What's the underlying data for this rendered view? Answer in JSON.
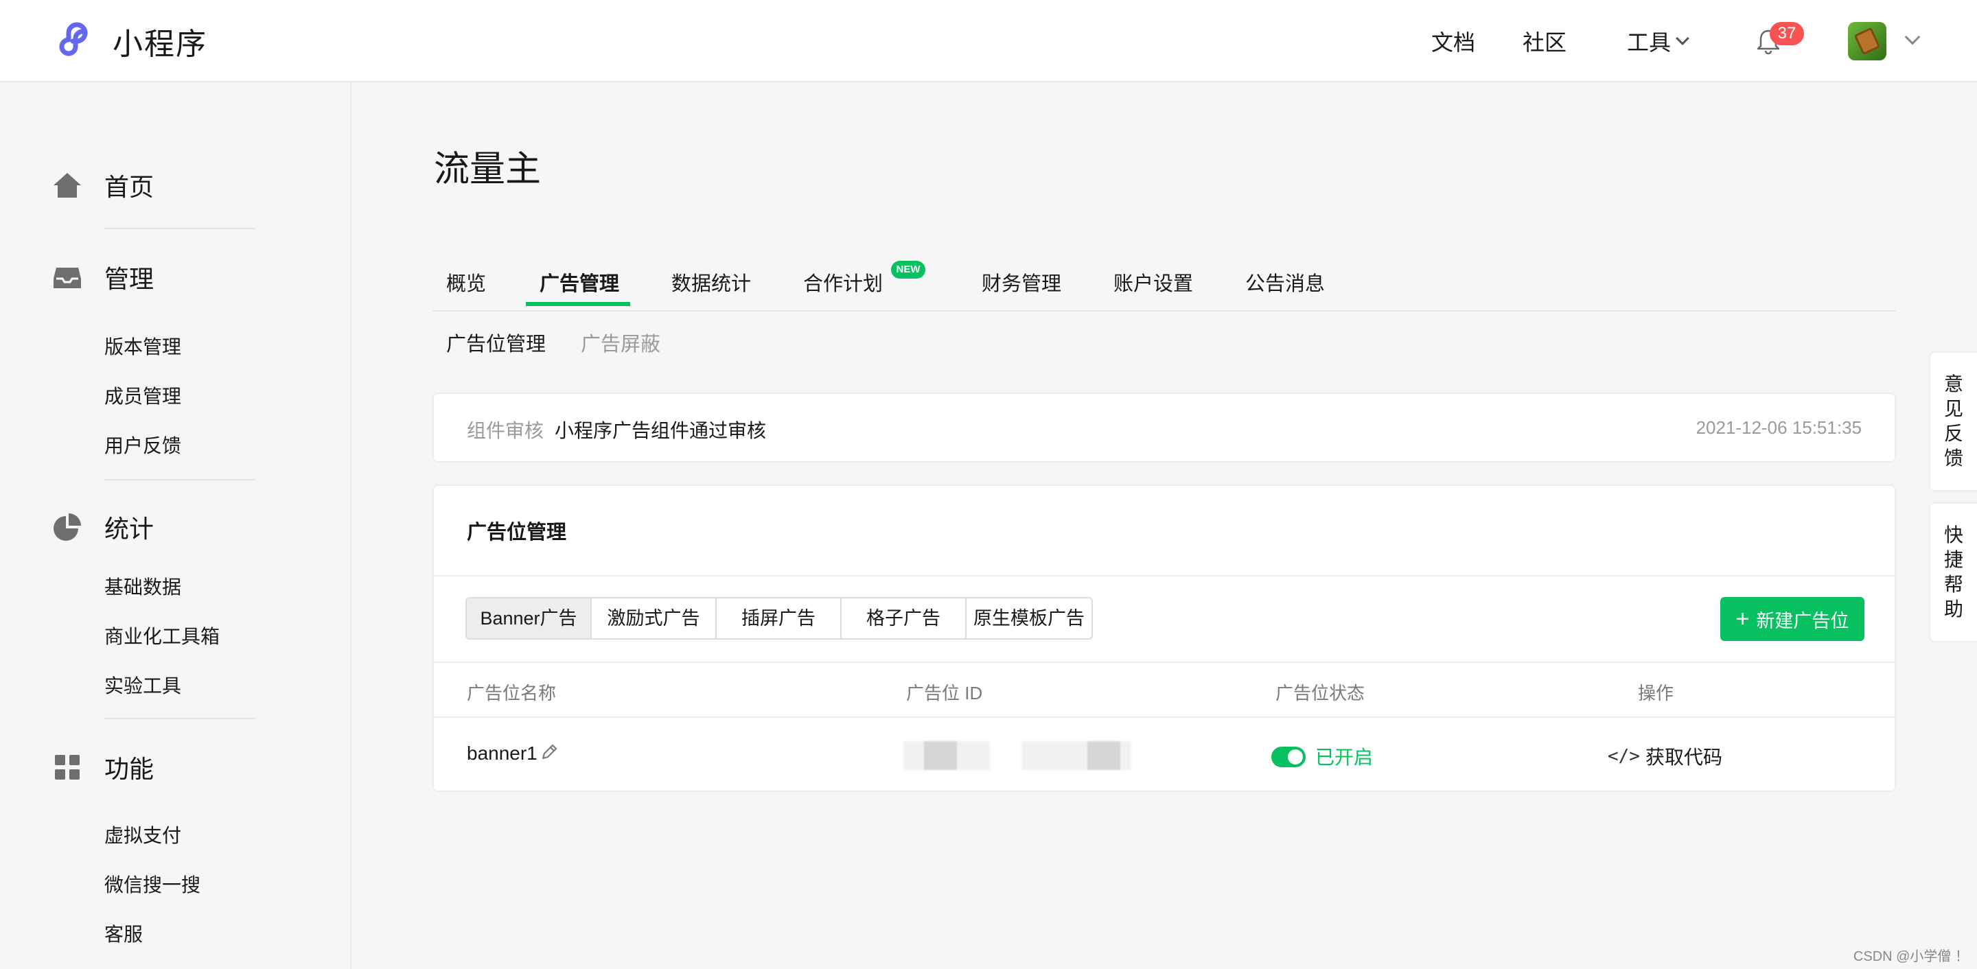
{
  "header": {
    "app_title": "小程序",
    "nav": [
      "文档",
      "社区",
      "工具"
    ],
    "notification_count": "37"
  },
  "sidebar": {
    "groups": [
      {
        "label": "首页",
        "icon": "home-icon",
        "items": []
      },
      {
        "label": "管理",
        "icon": "inbox-icon",
        "items": [
          "版本管理",
          "成员管理",
          "用户反馈"
        ]
      },
      {
        "label": "统计",
        "icon": "pie-chart-icon",
        "items": [
          "基础数据",
          "商业化工具箱",
          "实验工具"
        ]
      },
      {
        "label": "功能",
        "icon": "grid-icon",
        "items": [
          "虚拟支付",
          "微信搜一搜",
          "客服"
        ]
      }
    ]
  },
  "main": {
    "title": "流量主",
    "tabs": [
      "概览",
      "广告管理",
      "数据统计",
      "合作计划",
      "财务管理",
      "账户设置",
      "公告消息"
    ],
    "active_tab": "广告管理",
    "new_badge": "NEW",
    "subtabs": [
      "广告位管理",
      "广告屏蔽"
    ],
    "review": {
      "label": "组件审核",
      "text": "小程序广告组件通过审核",
      "time": "2021-12-06 15:51:35"
    },
    "ad_card": {
      "title": "广告位管理",
      "ad_types": [
        "Banner广告",
        "激励式广告",
        "插屏广告",
        "格子广告",
        "原生模板广告"
      ],
      "active_type": "Banner广告",
      "new_button": "新建广告位",
      "columns": [
        "广告位名称",
        "广告位 ID",
        "广告位状态",
        "操作"
      ],
      "rows": [
        {
          "name": "banner1",
          "status": "已开启",
          "action": "获取代码",
          "enabled": true
        }
      ]
    }
  },
  "floating": {
    "feedback": [
      "意",
      "见",
      "反",
      "馈"
    ],
    "help": [
      "快",
      "捷",
      "帮",
      "助"
    ]
  },
  "watermark": "CSDN @小学僧 ！",
  "colors": {
    "accent": "#07c160",
    "badge": "#fa5151"
  }
}
